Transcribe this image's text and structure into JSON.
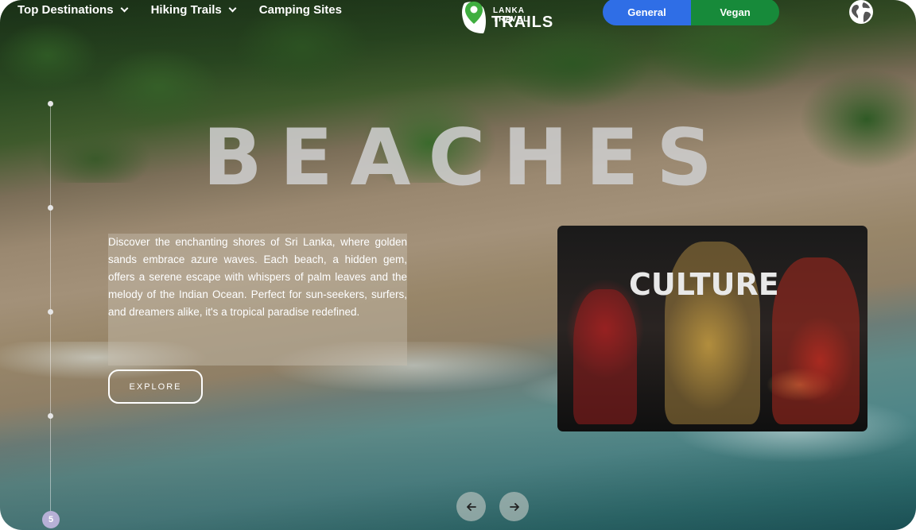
{
  "nav": {
    "items": [
      {
        "label": "Top Destinations",
        "has_dropdown": true
      },
      {
        "label": "Hiking Trails",
        "has_dropdown": true
      },
      {
        "label": "Camping Sites",
        "has_dropdown": false
      }
    ]
  },
  "logo": {
    "top_text": "LANKA TRAVEL",
    "main_text": "TRAILS"
  },
  "toggle": {
    "general_label": "General",
    "vegan_label": "Vegan",
    "general_color": "#2f6ee6",
    "vegan_color": "#178a3a"
  },
  "hero": {
    "heading": "BEACHES",
    "description": "Discover the enchanting shores of Sri Lanka, where golden sands embrace azure waves. Each beach, a hidden gem, offers a serene escape with whispers of palm leaves and the melody of the Indian Ocean. Perfect for sun-seekers, surfers, and dreamers alike, it's a tropical paradise redefined.",
    "explore_label": "EXPLORE"
  },
  "next_card": {
    "label": "CULTURE"
  },
  "slider": {
    "current_slide": "5",
    "dots_count": 4
  },
  "icons": {
    "globe": "globe-icon",
    "prev": "arrow-left-icon",
    "next": "arrow-right-icon"
  }
}
